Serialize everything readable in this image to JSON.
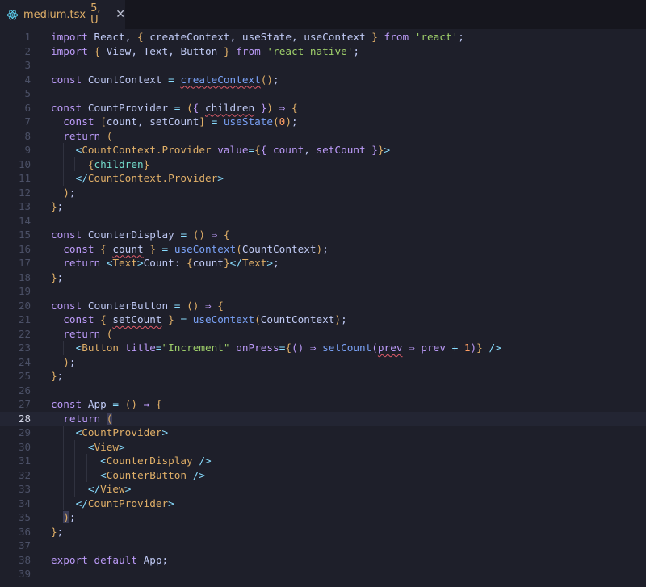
{
  "tab": {
    "filename": "medium.tsx",
    "status": "5, U",
    "icon": "react-icon",
    "close_glyph": "✕"
  },
  "editor": {
    "current_line": 28,
    "lines": [
      {
        "n": "1",
        "t": "import React, { createContext, useState, useContext } from 'react';"
      },
      {
        "n": "2",
        "t": "import { View, Text, Button } from 'react-native';"
      },
      {
        "n": "3",
        "t": ""
      },
      {
        "n": "4",
        "t": "const CountContext = createContext();"
      },
      {
        "n": "5",
        "t": ""
      },
      {
        "n": "6",
        "t": "const CountProvider = ({ children }) ⇒ {"
      },
      {
        "n": "7",
        "t": "  const [count, setCount] = useState(0);"
      },
      {
        "n": "8",
        "t": "  return ("
      },
      {
        "n": "9",
        "t": "    <CountContext.Provider value={{ count, setCount }}>"
      },
      {
        "n": "10",
        "t": "      {children}"
      },
      {
        "n": "11",
        "t": "    </CountContext.Provider>"
      },
      {
        "n": "12",
        "t": "  );"
      },
      {
        "n": "13",
        "t": "};"
      },
      {
        "n": "14",
        "t": ""
      },
      {
        "n": "15",
        "t": "const CounterDisplay = () ⇒ {"
      },
      {
        "n": "16",
        "t": "  const { count } = useContext(CountContext);"
      },
      {
        "n": "17",
        "t": "  return <Text>Count: {count}</Text>;"
      },
      {
        "n": "18",
        "t": "};"
      },
      {
        "n": "19",
        "t": ""
      },
      {
        "n": "20",
        "t": "const CounterButton = () ⇒ {"
      },
      {
        "n": "21",
        "t": "  const { setCount } = useContext(CountContext);"
      },
      {
        "n": "22",
        "t": "  return ("
      },
      {
        "n": "23",
        "t": "    <Button title=\"Increment\" onPress={() ⇒ setCount(prev ⇒ prev + 1)} />"
      },
      {
        "n": "24",
        "t": "  );"
      },
      {
        "n": "25",
        "t": "};"
      },
      {
        "n": "26",
        "t": ""
      },
      {
        "n": "27",
        "t": "const App = () ⇒ {"
      },
      {
        "n": "28",
        "t": "  return ("
      },
      {
        "n": "29",
        "t": "    <CountProvider>"
      },
      {
        "n": "30",
        "t": "      <View>"
      },
      {
        "n": "31",
        "t": "        <CounterDisplay />"
      },
      {
        "n": "32",
        "t": "        <CounterButton />"
      },
      {
        "n": "33",
        "t": "      </View>"
      },
      {
        "n": "34",
        "t": "    </CountProvider>"
      },
      {
        "n": "35",
        "t": "  );"
      },
      {
        "n": "36",
        "t": "};"
      },
      {
        "n": "37",
        "t": ""
      },
      {
        "n": "38",
        "t": "export default App;"
      },
      {
        "n": "39",
        "t": ""
      }
    ]
  },
  "colors": {
    "background": "#1e1f2a",
    "tab_bar": "#16161e",
    "keyword": "#bb9af7",
    "string": "#9ece6a",
    "function": "#7aa2f7",
    "component": "#e0af68",
    "error_squiggle": "#e05c6a"
  }
}
